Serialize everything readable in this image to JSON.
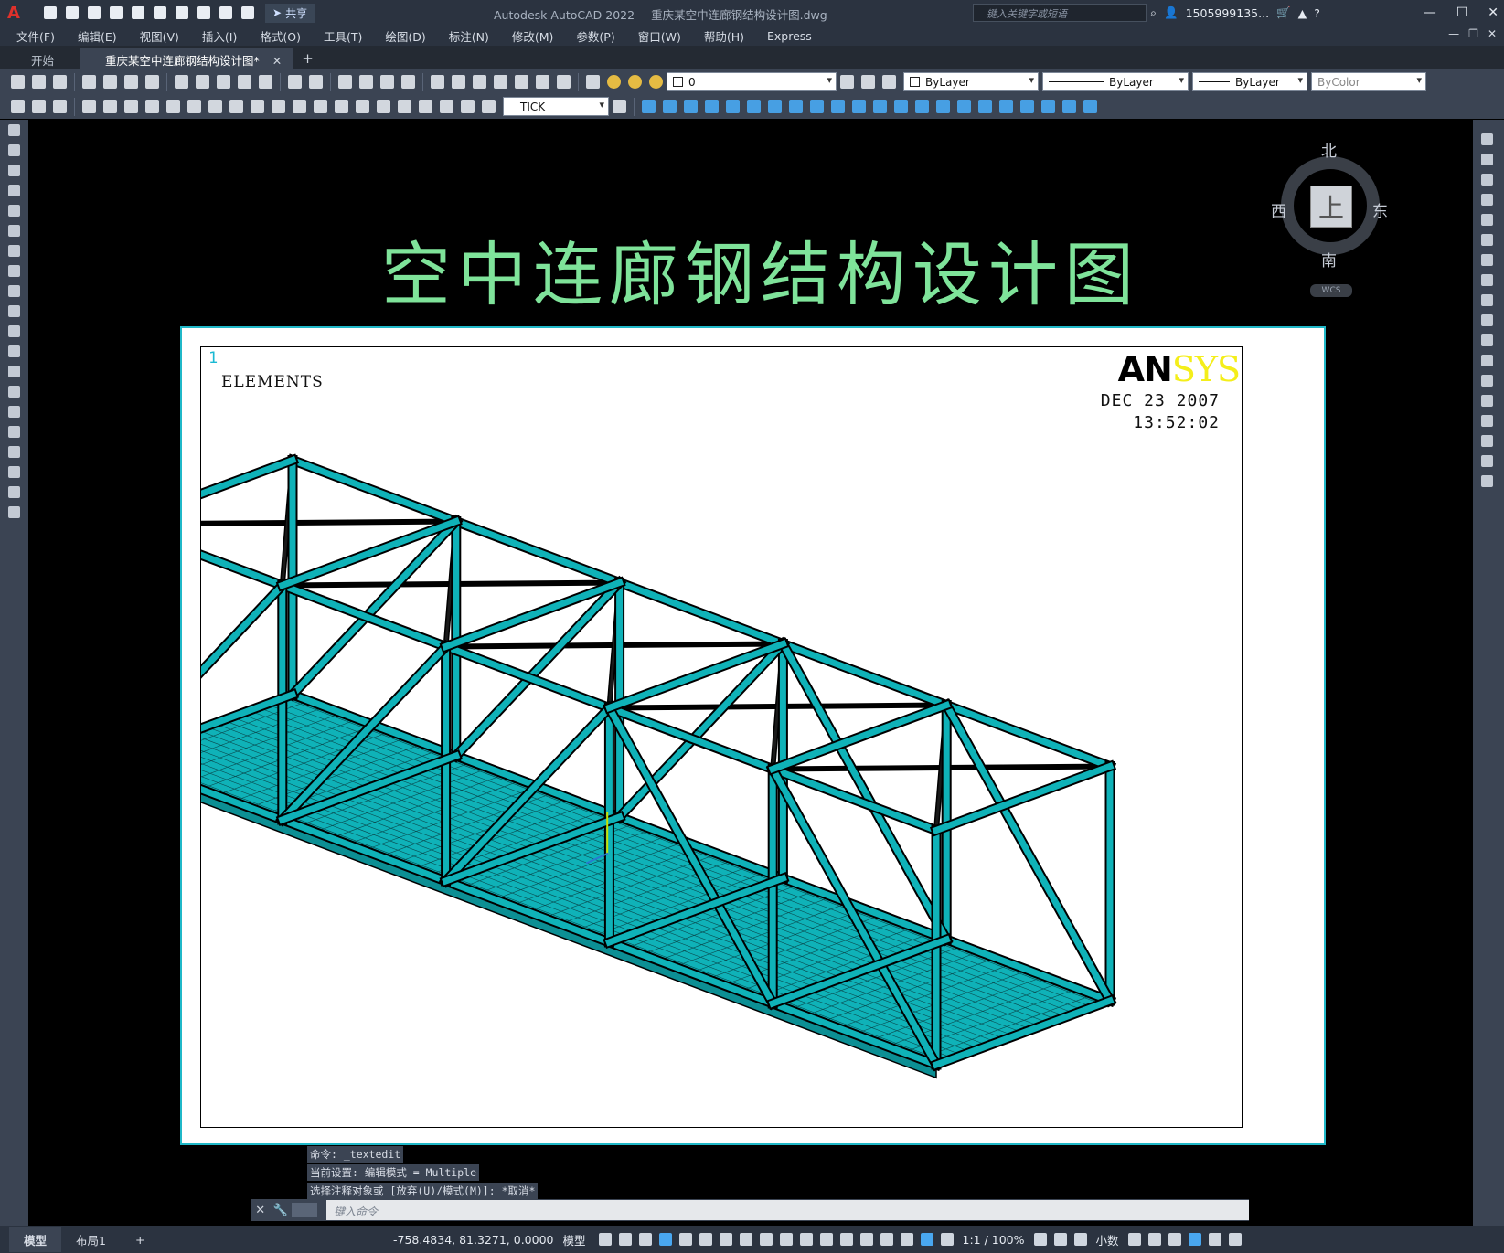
{
  "window": {
    "app_title": "Autodesk AutoCAD 2022",
    "doc_title": "重庆某空中连廊钢结构设计图.dwg",
    "search_placeholder": "键入关键字或短语",
    "user": "1505999135...",
    "share_label": "共享"
  },
  "menu": [
    "文件(F)",
    "编辑(E)",
    "视图(V)",
    "插入(I)",
    "格式(O)",
    "工具(T)",
    "绘图(D)",
    "标注(N)",
    "修改(M)",
    "参数(P)",
    "窗口(W)",
    "帮助(H)",
    "Express"
  ],
  "tabs": {
    "start": "开始",
    "active": "重庆某空中连廊钢结构设计图*",
    "close": "✕",
    "add": "+"
  },
  "toolbar": {
    "layer": "0",
    "color": "ByLayer",
    "linetype": "ByLayer",
    "lineweight": "ByLayer",
    "plotstyle": "ByColor",
    "dimstyle": "TICK"
  },
  "drawing": {
    "title": "空中连廊钢结构设计图",
    "ansys": {
      "window_number": "1",
      "label": "ELEMENTS",
      "brand_a": "AN",
      "brand_b": "SYS",
      "date": "DEC 23 2007",
      "time": "13:52:02"
    }
  },
  "viewcube": {
    "north": "北",
    "south": "南",
    "east": "东",
    "west": "西",
    "face": "上",
    "wcs": "WCS"
  },
  "command": {
    "history": [
      "命令: _textedit",
      "当前设置: 编辑模式 = Multiple",
      "选择注释对象或 [放弃(U)/模式(M)]: *取消*"
    ],
    "placeholder": "键入命令"
  },
  "layout_tabs": [
    "模型",
    "布局1",
    "+"
  ],
  "status": {
    "coords": "-758.4834, 81.3271, 0.0000",
    "space": "模型",
    "scale": "1:1 / 100%",
    "units": "小数"
  }
}
